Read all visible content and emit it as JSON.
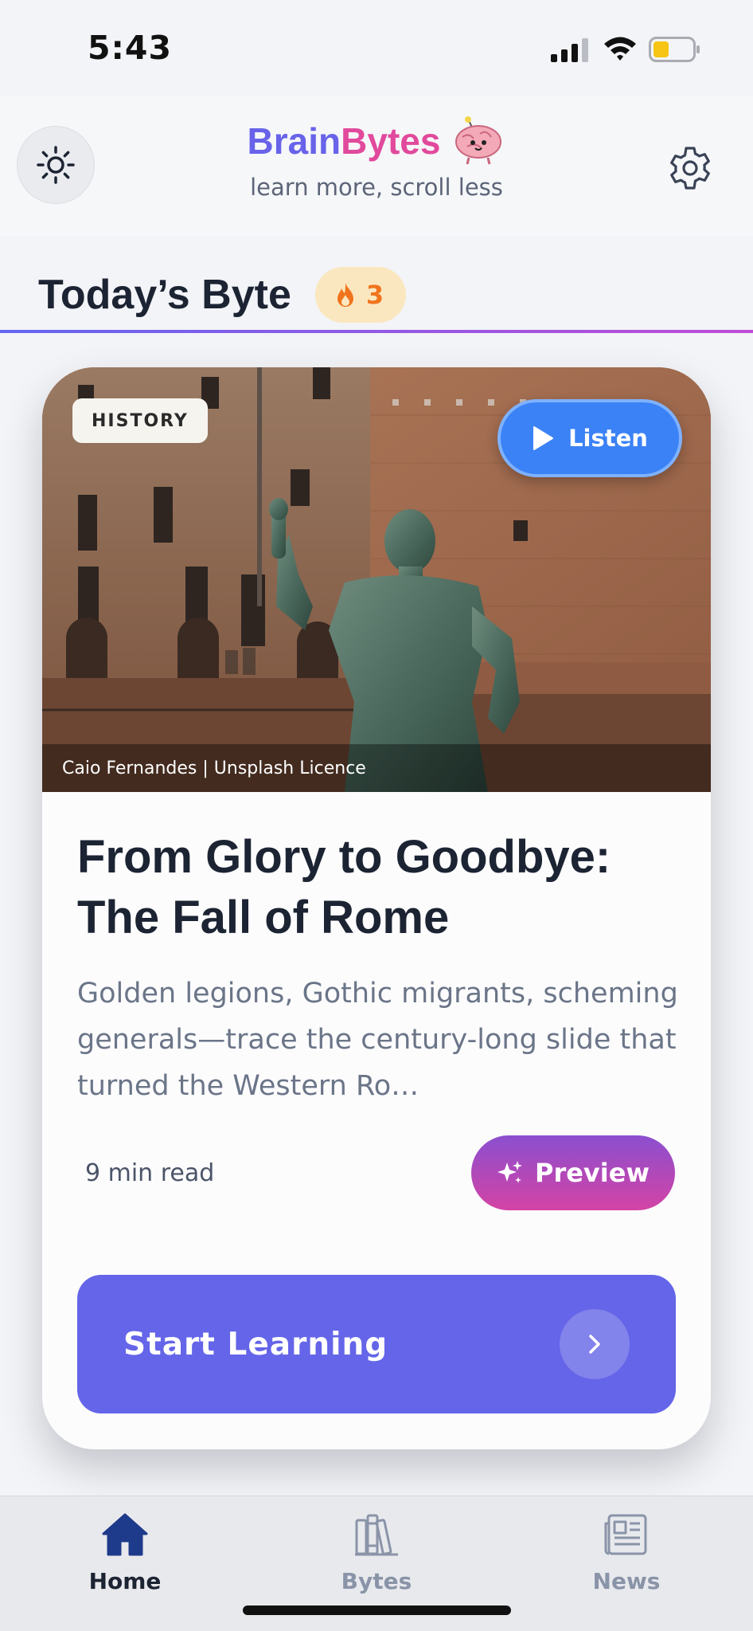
{
  "status_bar": {
    "time": "5:43",
    "icons": [
      "cellular-signal-icon",
      "wifi-icon",
      "battery-low-icon"
    ]
  },
  "header": {
    "brand_part1": "Brain",
    "brand_part2": "Bytes",
    "tagline": "learn more, scroll less",
    "icons": {
      "left": "sun-icon",
      "right": "gear-icon",
      "mascot": "brain-mascot-icon"
    }
  },
  "today": {
    "title": "Today’s Byte",
    "streak_count": "3",
    "streak_icon": "flame-icon"
  },
  "card": {
    "category": "HISTORY",
    "listen_label": "Listen",
    "photo_credit": "Caio Fernandes | Unsplash Licence",
    "title": "From Glory to Goodbye: The Fall of Rome",
    "summary": "Golden legions, Gothic migrants, scheming generals—trace the century-long slide that turned the Western Ro…",
    "read_time": "9 min read",
    "preview_label": "Preview",
    "start_label": "Start Learning"
  },
  "bottom_nav": {
    "items": [
      {
        "label": "Home",
        "icon": "home-icon",
        "active": true
      },
      {
        "label": "Bytes",
        "icon": "books-icon",
        "active": false
      },
      {
        "label": "News",
        "icon": "newspaper-icon",
        "active": false
      }
    ]
  },
  "colors": {
    "accent": "#6366f1",
    "brand_pink": "#e14a9c",
    "listen_blue": "#3b82f6",
    "streak_orange": "#f0741d",
    "nav_active": "#1e3a8a",
    "nav_inactive": "#8a94a8"
  }
}
